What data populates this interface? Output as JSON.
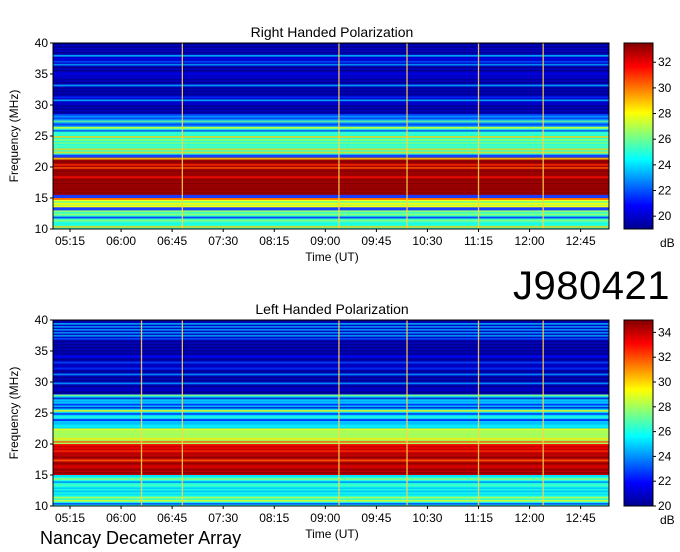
{
  "observation_id": "J980421",
  "instrument": "Nancay Decameter Array",
  "chart_data": [
    {
      "type": "heatmap",
      "title": "Right Handed Polarization",
      "xlabel": "Time (UT)",
      "ylabel": "Frequency (MHz)",
      "x_ticks": [
        "05:15",
        "06:00",
        "06:45",
        "07:30",
        "08:15",
        "09:00",
        "09:45",
        "10:30",
        "11:15",
        "12:00",
        "12:45"
      ],
      "xlim": [
        "05:00",
        "13:10"
      ],
      "y_ticks": [
        10,
        15,
        20,
        25,
        30,
        35,
        40
      ],
      "ylim": [
        10,
        40
      ],
      "colorbar": {
        "label": "dB",
        "ticks": [
          20,
          22,
          24,
          26,
          28,
          30,
          32
        ],
        "range": [
          19,
          33.5
        ]
      },
      "intense_bands_mhz": [
        {
          "low": 15.5,
          "high": 21.5,
          "level_db": 33
        },
        {
          "low": 13.5,
          "high": 15.0,
          "level_db": 28
        },
        {
          "low": 10.0,
          "high": 13.0,
          "level_db": 25
        },
        {
          "low": 22.0,
          "high": 26.5,
          "level_db": 25
        },
        {
          "low": 26.5,
          "high": 28.5,
          "level_db": 23
        },
        {
          "low": 28.5,
          "high": 40.0,
          "level_db": 20
        }
      ],
      "vertical_lines_ut": [
        "06:54",
        "09:12",
        "10:12",
        "11:15",
        "12:12"
      ]
    },
    {
      "type": "heatmap",
      "title": "Left Handed Polarization",
      "xlabel": "Time (UT)",
      "ylabel": "Frequency (MHz)",
      "x_ticks": [
        "05:15",
        "06:00",
        "06:45",
        "07:30",
        "08:15",
        "09:00",
        "09:45",
        "10:30",
        "11:15",
        "12:00",
        "12:45"
      ],
      "xlim": [
        "05:00",
        "13:10"
      ],
      "y_ticks": [
        10,
        15,
        20,
        25,
        30,
        35,
        40
      ],
      "ylim": [
        10,
        40
      ],
      "colorbar": {
        "label": "dB",
        "ticks": [
          20,
          22,
          24,
          26,
          28,
          30,
          32,
          34
        ],
        "range": [
          20,
          35
        ]
      },
      "intense_bands_mhz": [
        {
          "low": 15.0,
          "high": 20.0,
          "level_db": 34
        },
        {
          "low": 20.0,
          "high": 22.5,
          "level_db": 28
        },
        {
          "low": 10.0,
          "high": 15.0,
          "level_db": 26
        },
        {
          "low": 22.5,
          "high": 28.0,
          "level_db": 25
        },
        {
          "low": 28.0,
          "high": 40.0,
          "level_db": 21
        }
      ],
      "vertical_lines_ut": [
        "06:18",
        "06:54",
        "09:12",
        "10:12",
        "11:15",
        "12:12"
      ]
    }
  ]
}
